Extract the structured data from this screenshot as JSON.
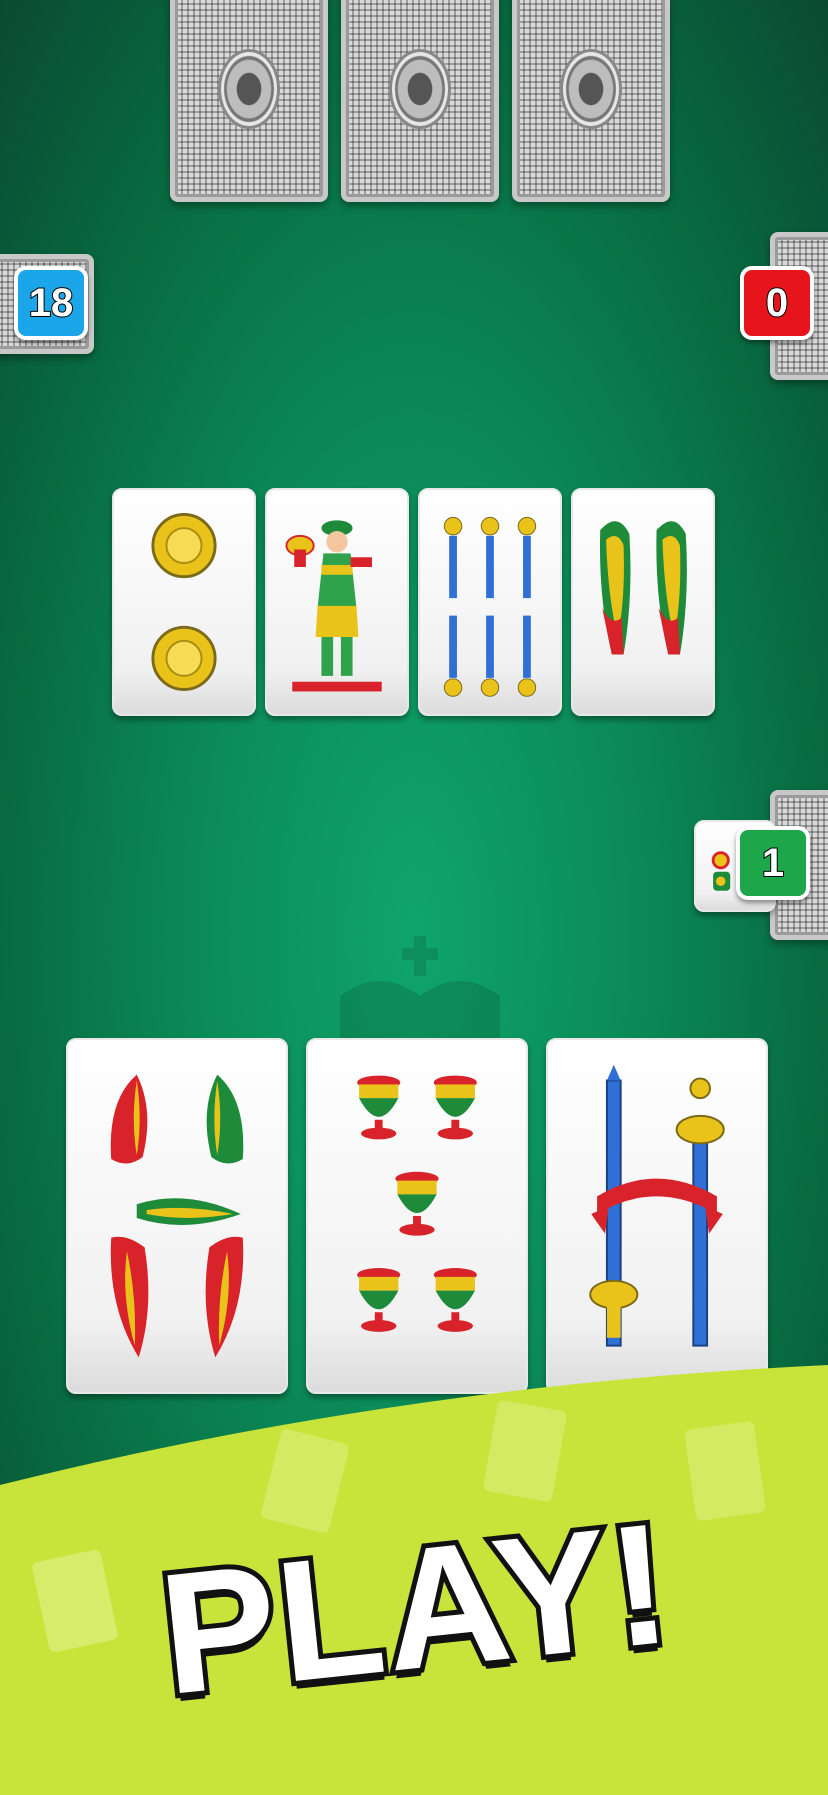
{
  "opponent_hand": {
    "count": 3
  },
  "scores": {
    "left_player": {
      "value": "18",
      "color": "#1aa6e8"
    },
    "right_player": {
      "value": "0",
      "color": "#e8141c"
    },
    "right_player_lower": {
      "value": "1",
      "color": "#1ea64a"
    }
  },
  "table_cards": [
    {
      "name": "card-2-of-coins",
      "suit": "coins",
      "rank": "2"
    },
    {
      "name": "card-knave-of-cups",
      "suit": "cups",
      "rank": "knave"
    },
    {
      "name": "card-6-of-swords",
      "suit": "swords",
      "rank": "6"
    },
    {
      "name": "card-2-of-batons",
      "suit": "batons",
      "rank": "2"
    }
  ],
  "player_hand": [
    {
      "name": "card-5-of-batons",
      "suit": "batons",
      "rank": "5"
    },
    {
      "name": "card-5-of-cups",
      "suit": "cups",
      "rank": "5"
    },
    {
      "name": "card-2-of-swords",
      "suit": "swords",
      "rank": "2"
    }
  ],
  "banner": {
    "text": "PLAY!",
    "color": "#c8e43a"
  },
  "colors": {
    "felt": "#0b8a57",
    "card_red": "#d8232a",
    "card_green": "#1d8b3a",
    "card_gold": "#e9c21a",
    "card_blue": "#2f6fd6"
  }
}
